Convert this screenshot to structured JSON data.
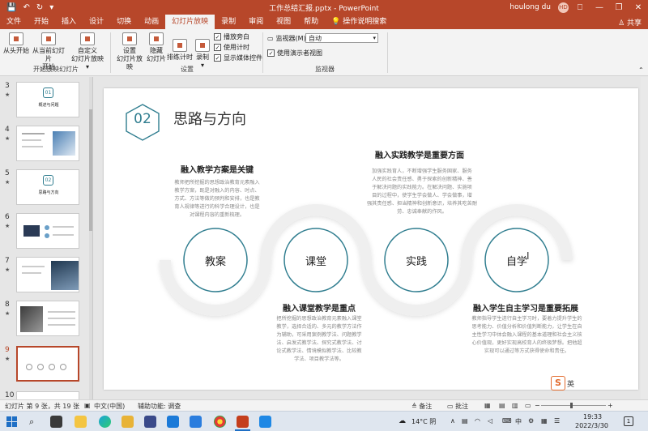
{
  "titlebar": {
    "doc_title": "工作总结汇报.pptx  -  PowerPoint",
    "user_name": "houlong du",
    "avatar_initials": "HD",
    "qa_save": "💾",
    "qa_undo": "↶",
    "qa_redo": "↻",
    "qa_more": "▾",
    "minimize": "—",
    "restore": "❐",
    "close": "✕",
    "ribbon_display": "⎕"
  },
  "tabs": [
    {
      "label": "文件"
    },
    {
      "label": "开始"
    },
    {
      "label": "插入"
    },
    {
      "label": "设计"
    },
    {
      "label": "切换"
    },
    {
      "label": "动画"
    },
    {
      "label": "幻灯片放映"
    },
    {
      "label": "录制"
    },
    {
      "label": "审阅"
    },
    {
      "label": "视图"
    },
    {
      "label": "帮助"
    },
    {
      "label": "💡 操作说明搜索"
    }
  ],
  "share_label": "♙ 共享",
  "ribbon": {
    "btn_from_start": "从头开始",
    "btn_from_current_1": "从当前幻灯片",
    "btn_from_current_2": "开始",
    "btn_custom_1": "自定义",
    "btn_custom_2": "幻灯片放映 ▾",
    "group_start": "开始放映幻灯片",
    "btn_setup_1": "设置",
    "btn_setup_2": "幻灯片放映",
    "btn_hide_1": "隐藏",
    "btn_hide_2": "幻灯片",
    "btn_rehearse": "排练计时",
    "btn_record": "录制",
    "btn_record_arrow": "▾",
    "chk_narration": "播放旁白",
    "chk_timing": "使用计时",
    "chk_media": "显示媒体控件",
    "group_setup": "设置",
    "monitor_label": "监视器(M):",
    "monitor_value": "自动",
    "chk_presenter": "使用演示者视图",
    "group_monitor": "监视器",
    "check_mark": "✓"
  },
  "thumbnails": [
    {
      "num": "3",
      "star": "★",
      "label": "01",
      "sub": "概述与问题"
    },
    {
      "num": "4",
      "star": "★"
    },
    {
      "num": "5",
      "star": "★",
      "label": "02",
      "sub": "思路与方向"
    },
    {
      "num": "6",
      "star": "★"
    },
    {
      "num": "7",
      "star": "★"
    },
    {
      "num": "8",
      "star": "★"
    },
    {
      "num": "9",
      "star": "★"
    },
    {
      "num": "10",
      "star": ""
    }
  ],
  "slide": {
    "number_badge": "02",
    "title": "思路与方向",
    "blocks": [
      {
        "title": "融入教学方案是关键",
        "body": [
          "教师把所挖掘的思想政治教育元素融入",
          "教学方案，既是对融入的内容、时点、",
          "方式、方法等做的预判和安排，也是教",
          "育人规律等进行的科学合理设计，也是",
          "对课程内容的重新梳理。"
        ]
      },
      {
        "title": "融入实践教学是重要方面",
        "body": [
          "加强实践育人，不断增强学生服务国家、服务",
          "人民的社会责任感、勇于探索的创新精神、善",
          "于解决问题的实践能力。在解决问题、实施项",
          "目的过程中，使学生学会做人、学会做事，增",
          "强其责任感、担当精神和创新意识，培养其吃苦耐",
          "劳、忠诚奉献的作风。"
        ]
      },
      {
        "title": "融入课堂教学是重点",
        "body": [
          "把所挖掘的思想政治教育元素融入课堂",
          "教学，选择合适的、多元的教学方法作",
          "为辅助，可采用案例教学法、问题教学",
          "法、启发式教学法、探究式教学法、讨",
          "论式教学法、情境模拟教学法、比较教",
          "学法、项目教学法等。"
        ]
      },
      {
        "title": "融入学生自主学习是重要拓展",
        "body": [
          "教师指导学生进行自主学习时，要着力提升学生的",
          "思考能力、价值分析和价值判断能力，让学生在自",
          "主性学习中体会融入课程的基本道理和社会主义核",
          "心价值观，更好实现高校育人的终极梦想。把他超",
          "实现可以通过等方式获得使命和责任。"
        ]
      }
    ],
    "circles": [
      "教案",
      "课堂",
      "实践",
      "自学"
    ],
    "cursor_glyph": "I"
  },
  "statusbar": {
    "slide_info": "幻灯片 第 9 张，共 19 张",
    "language": "中文(中国)",
    "accessibility": "辅助功能: 调查",
    "notes": "≜ 备注",
    "comments": "▭ 批注",
    "zoom_minus": "−",
    "zoom_plus": "+"
  },
  "taskbar": {
    "weather": "14°C 阴",
    "time": "19:33",
    "date": "2022/3/30",
    "notif_count": "1",
    "ime": "中",
    "ime2": "英",
    "caret": "∧"
  },
  "colors": {
    "accent": "#b7472a",
    "teal": "#2f7d8f",
    "ribbon_bg": "#f3f3f3"
  }
}
